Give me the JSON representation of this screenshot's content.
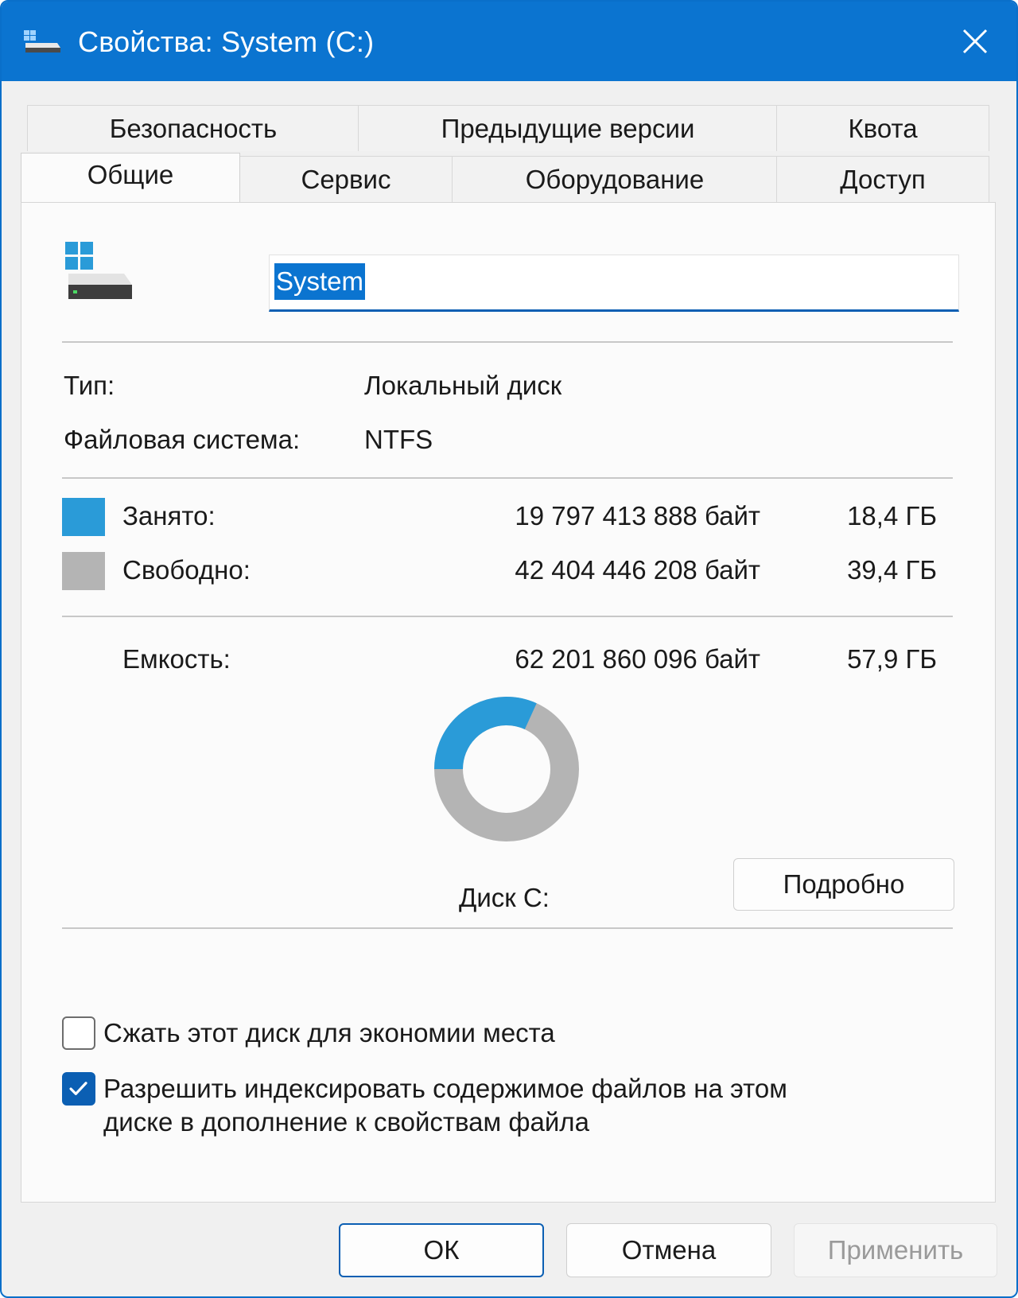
{
  "window": {
    "title": "Свойства: System (C:)"
  },
  "tabs": {
    "row1": [
      "Безопасность",
      "Предыдущие версии",
      "Квота"
    ],
    "row2": [
      "Общие",
      "Сервис",
      "Оборудование",
      "Доступ"
    ],
    "active": "Общие"
  },
  "general": {
    "name_value": "System",
    "type_label": "Тип:",
    "type_value": "Локальный диск",
    "fs_label": "Файловая система:",
    "fs_value": "NTFS",
    "used_label": "Занято:",
    "used_bytes": "19 797 413 888 байт",
    "used_gb": "18,4 ГБ",
    "free_label": "Свободно:",
    "free_bytes": "42 404 446 208 байт",
    "free_gb": "39,4 ГБ",
    "capacity_label": "Емкость:",
    "capacity_bytes": "62 201 860 096 байт",
    "capacity_gb": "57,9 ГБ",
    "disk_label": "Диск C:",
    "details_button": "Подробно",
    "used_fraction": 0.318
  },
  "options": {
    "compress_label": "Сжать этот диск для экономии места",
    "compress_checked": false,
    "index_label_line1": "Разрешить индексировать содержимое файлов на этом",
    "index_label_line2": "диске в дополнение к свойствам файла",
    "index_checked": true
  },
  "buttons": {
    "ok": "ОК",
    "cancel": "Отмена",
    "apply": "Применить"
  },
  "colors": {
    "accent": "#0b74d0",
    "used": "#2a9bd8",
    "free": "#b4b4b4"
  }
}
